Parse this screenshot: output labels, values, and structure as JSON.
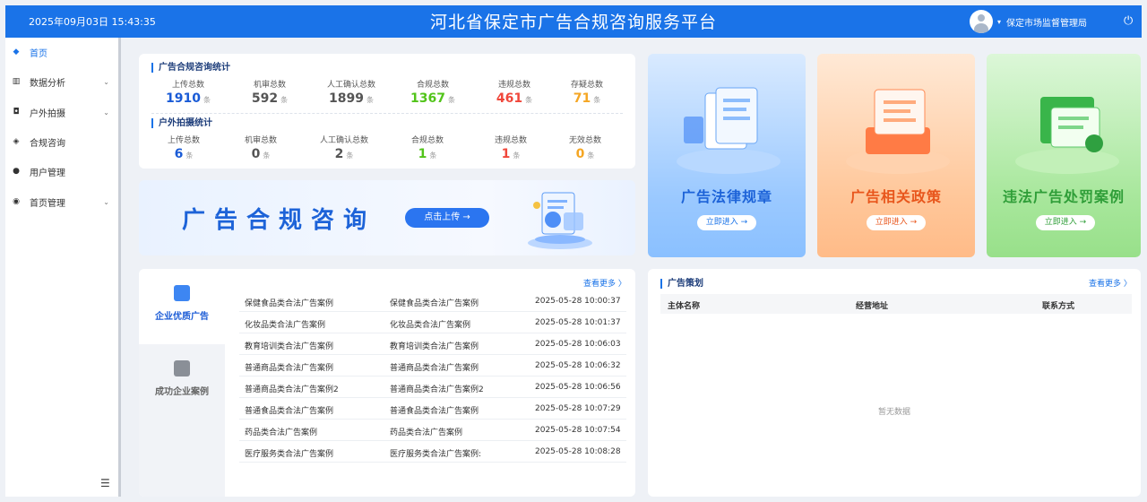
{
  "header": {
    "datetime": "2025年09月03日 15:43:35",
    "title": "河北省保定市广告合规咨询服务平台",
    "user": "保定市场监督管理局"
  },
  "icons": {
    "caret": "▾",
    "power": "⏻",
    "chevron": "⌄",
    "collapse": "☰",
    "arrow": "→",
    "right": "〉"
  },
  "sidebar": {
    "items": [
      {
        "label": "首页",
        "icon": "◆"
      },
      {
        "label": "数据分析",
        "icon": "▥"
      },
      {
        "label": "户外拍摄",
        "icon": "◘"
      },
      {
        "label": "合规咨询",
        "icon": "◈"
      },
      {
        "label": "用户管理",
        "icon": "●"
      },
      {
        "label": "首页管理",
        "icon": "◉"
      }
    ]
  },
  "stats": {
    "compliance": {
      "title": "广告合规咨询统计",
      "items": [
        {
          "label": "上传总数",
          "value": "1910",
          "unit": "条"
        },
        {
          "label": "机审总数",
          "value": "592",
          "unit": "条"
        },
        {
          "label": "人工确认总数",
          "value": "1899",
          "unit": "条"
        },
        {
          "label": "合规总数",
          "value": "1367",
          "unit": "条"
        },
        {
          "label": "违规总数",
          "value": "461",
          "unit": "条"
        },
        {
          "label": "存疑总数",
          "value": "71",
          "unit": "条"
        }
      ]
    },
    "outdoor": {
      "title": "户外拍摄统计",
      "items": [
        {
          "label": "上传总数",
          "value": "6",
          "unit": "条"
        },
        {
          "label": "机审总数",
          "value": "0",
          "unit": "条"
        },
        {
          "label": "人工确认总数",
          "value": "2",
          "unit": "条"
        },
        {
          "label": "合规总数",
          "value": "1",
          "unit": "条"
        },
        {
          "label": "违规总数",
          "value": "1",
          "unit": "条"
        },
        {
          "label": "无效总数",
          "value": "0",
          "unit": "条"
        }
      ]
    }
  },
  "banner": {
    "text": "广告合规咨询",
    "button": "点击上传"
  },
  "cards": [
    {
      "title": "广告法律规章",
      "button": "立即进入"
    },
    {
      "title": "广告相关政策",
      "button": "立即进入"
    },
    {
      "title": "违法广告处罚案例",
      "button": "立即进入"
    }
  ],
  "cases": {
    "tabs": [
      "企业优质广告",
      "成功企业案例"
    ],
    "more": "查看更多",
    "rows": [
      {
        "name": "保健食品类合法广告案例",
        "type": "保健食品类合法广告案例",
        "time": "2025-05-28 10:00:37"
      },
      {
        "name": "化妆品类合法广告案例",
        "type": "化妆品类合法广告案例",
        "time": "2025-05-28 10:01:37"
      },
      {
        "name": "教育培训类合法广告案例",
        "type": "教育培训类合法广告案例",
        "time": "2025-05-28 10:06:03"
      },
      {
        "name": "普通商品类合法广告案例",
        "type": "普通商品类合法广告案例",
        "time": "2025-05-28 10:06:32"
      },
      {
        "name": "普通商品类合法广告案例2",
        "type": "普通商品类合法广告案例2",
        "time": "2025-05-28 10:06:56"
      },
      {
        "name": "普通食品类合法广告案例",
        "type": "普通食品类合法广告案例",
        "time": "2025-05-28 10:07:29"
      },
      {
        "name": "药品类合法广告案例",
        "type": "药品类合法广告案例",
        "time": "2025-05-28 10:07:54"
      },
      {
        "name": "医疗服务类合法广告案例",
        "type": "医疗服务类合法广告案例:",
        "time": "2025-05-28 10:08:28"
      }
    ]
  },
  "planning": {
    "title": "广告策划",
    "more": "查看更多",
    "columns": [
      "主体名称",
      "经营地址",
      "联系方式"
    ],
    "empty": "暂无数据"
  }
}
